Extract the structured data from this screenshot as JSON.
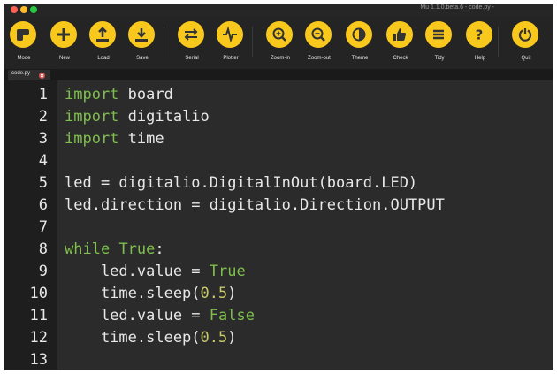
{
  "window": {
    "title": "Mu 1.1.0.beta.6 - code.py -",
    "colors": {
      "close": "#ff5f56",
      "minimize": "#ffbd2e",
      "zoom": "#27c93f",
      "accent": "#f9c81d",
      "keyword": "#7fbf4d",
      "number": "#c8c86a"
    }
  },
  "toolbar": {
    "buttons": [
      {
        "id": "mode",
        "label": "Mode",
        "icon": "mode-icon"
      },
      {
        "id": "new",
        "label": "New",
        "icon": "plus-icon"
      },
      {
        "id": "load",
        "label": "Load",
        "icon": "upload-icon"
      },
      {
        "id": "save",
        "label": "Save",
        "icon": "download-icon"
      },
      {
        "id": "serial",
        "label": "Serial",
        "icon": "arrows-icon"
      },
      {
        "id": "plotter",
        "label": "Plotter",
        "icon": "pulse-icon"
      },
      {
        "id": "zoom-in",
        "label": "Zoom-in",
        "icon": "zoom-in-icon"
      },
      {
        "id": "zoom-out",
        "label": "Zoom-out",
        "icon": "zoom-out-icon"
      },
      {
        "id": "theme",
        "label": "Theme",
        "icon": "contrast-icon"
      },
      {
        "id": "check",
        "label": "Check",
        "icon": "thumbs-up-icon"
      },
      {
        "id": "tidy",
        "label": "Tidy",
        "icon": "list-icon"
      },
      {
        "id": "help",
        "label": "Help",
        "icon": "question-icon"
      },
      {
        "id": "quit",
        "label": "Quit",
        "icon": "power-icon"
      }
    ]
  },
  "tab": {
    "name": "code.py",
    "close_icon": "close-icon"
  },
  "editor": {
    "lines": [
      {
        "number": "1",
        "tokens": [
          {
            "text": "import",
            "kind": "keyword"
          },
          {
            "text": " board",
            "kind": "plain"
          }
        ]
      },
      {
        "number": "2",
        "tokens": [
          {
            "text": "import",
            "kind": "keyword"
          },
          {
            "text": " digitalio",
            "kind": "plain"
          }
        ]
      },
      {
        "number": "3",
        "tokens": [
          {
            "text": "import",
            "kind": "keyword"
          },
          {
            "text": " time",
            "kind": "plain"
          }
        ]
      },
      {
        "number": "4",
        "tokens": []
      },
      {
        "number": "5",
        "tokens": [
          {
            "text": "led = digitalio.DigitalInOut(board.LED)",
            "kind": "plain"
          }
        ]
      },
      {
        "number": "6",
        "tokens": [
          {
            "text": "led.direction = digitalio.Direction.OUTPUT",
            "kind": "plain"
          }
        ]
      },
      {
        "number": "7",
        "tokens": []
      },
      {
        "number": "8",
        "tokens": [
          {
            "text": "while",
            "kind": "keyword"
          },
          {
            "text": " ",
            "kind": "plain"
          },
          {
            "text": "True",
            "kind": "keyword"
          },
          {
            "text": ":",
            "kind": "plain"
          }
        ]
      },
      {
        "number": "9",
        "tokens": [
          {
            "text": "    led.value = ",
            "kind": "plain"
          },
          {
            "text": "True",
            "kind": "keyword"
          }
        ]
      },
      {
        "number": "10",
        "tokens": [
          {
            "text": "    time.sleep(",
            "kind": "plain"
          },
          {
            "text": "0.5",
            "kind": "number"
          },
          {
            "text": ")",
            "kind": "plain"
          }
        ]
      },
      {
        "number": "11",
        "tokens": [
          {
            "text": "    led.value = ",
            "kind": "plain"
          },
          {
            "text": "False",
            "kind": "keyword"
          }
        ]
      },
      {
        "number": "12",
        "tokens": [
          {
            "text": "    time.sleep(",
            "kind": "plain"
          },
          {
            "text": "0.5",
            "kind": "number"
          },
          {
            "text": ")",
            "kind": "plain"
          }
        ]
      },
      {
        "number": "13",
        "tokens": []
      }
    ]
  }
}
